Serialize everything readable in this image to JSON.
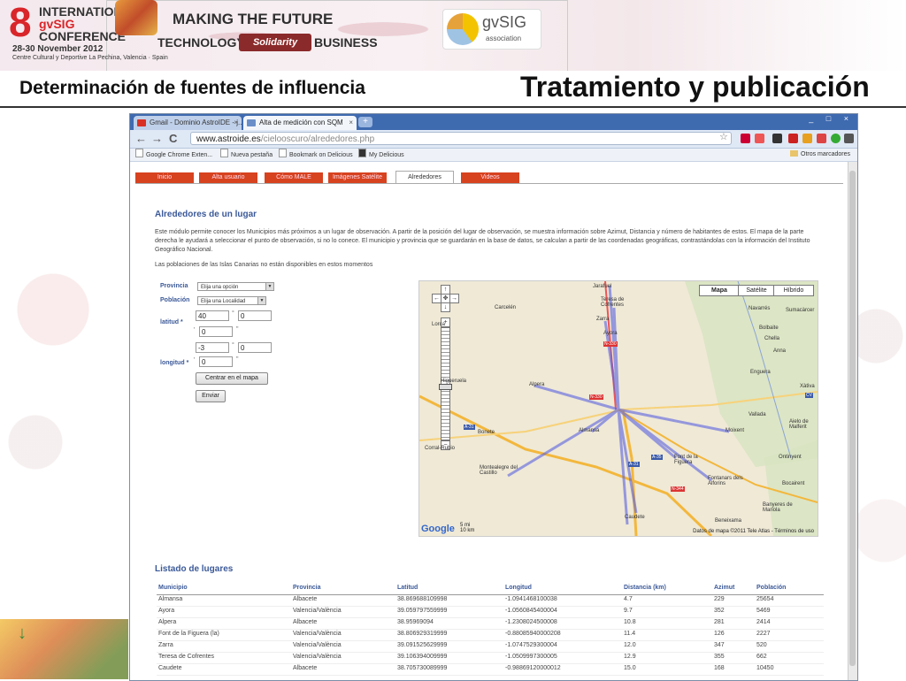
{
  "conference": {
    "number": "8",
    "line1": "INTERNATIONAL",
    "line2": "gvSIG",
    "line3": "CONFERENCE",
    "date": "28-30 November 2012",
    "place": "Centre Cultural y Deportive La Pechina, Valencia · Spain",
    "slogan1": "MAKING THE FUTURE",
    "slogan2": "TECHNOLOGY",
    "slogan_badge": "Solidarity",
    "slogan3": "BUSINESS",
    "logo_name": "gvSIG",
    "logo_sub": "association"
  },
  "slide": {
    "subtitle": "Determinación de fuentes de influencia",
    "title": "Tratamiento y publicación"
  },
  "browser": {
    "tabs": [
      {
        "label": "Gmail - Dominio AstroIDE - j...",
        "fav_color": "#d93025"
      },
      {
        "label": "Alta de medición con SQM",
        "fav_color": "#6a8fc8"
      }
    ],
    "new_tab": "+",
    "window_buttons": "_ □ ×",
    "nav": {
      "back": "←",
      "forward": "→",
      "reload": "C"
    },
    "url_host": "www.astroide.es",
    "url_path": "/cielooscuro/alrededores.php",
    "bookmarks": [
      "Google Chrome Exten...",
      "Nueva pestaña",
      "Bookmark on Delicious",
      "My Delicious"
    ],
    "other_bookmarks": "Otros marcadores",
    "extension_colors": [
      "#c03",
      "#e55",
      "#333",
      "#c22",
      "#e8a020",
      "#d44",
      "#3a3",
      "#555"
    ]
  },
  "site": {
    "menu": [
      "Inicio",
      "Alta usuario",
      "Cómo MALE",
      "Imágenes Satélite",
      "Alrededores",
      "Videos"
    ],
    "active_menu": "Alrededores",
    "heading": "Alrededores de un lugar",
    "intro": "Este módulo permite conocer los Municipios más próximos a un lugar de observación. A partir de la posición del lugar de observación, se muestra información sobre Azimut, Distancia y número de habitantes de estos. El mapa de la parte derecha le ayudará a seleccionar el punto de observación, si no lo conece. El municipio y provincia que se guardarán en la base de datos, se calculan a partir de las coordenadas geográficas, contrastándolas con la información del Instituto Geográfico Nacional.",
    "note": "Las poblaciones de las Islas Canarias no están disponibles en estos momentos",
    "form": {
      "provincia_label": "Provincia",
      "provincia_value": "Elija una opción",
      "poblacion_label": "Población",
      "poblacion_value": "Elija una Localidad",
      "latitud_label": "latitud",
      "lat_deg": "40",
      "lat_min": "0",
      "lat_sec": "0",
      "longitud_label": "longitud",
      "lon_deg": "-3",
      "lon_min": "0",
      "lon_sec": "0",
      "required_mark": "*",
      "deg_symbol": "°",
      "min_symbol": "'",
      "sec_symbol": "\"",
      "center_button": "Centrar en el mapa",
      "send_button": "Enviar"
    },
    "map": {
      "types": [
        "Mapa",
        "Satélite",
        "Híbrido"
      ],
      "active_type": "Mapa",
      "places": [
        "Jarafuel",
        "Teresa de Cofrentes",
        "Zarra",
        "Carcelén",
        "Ayora",
        "Alpera",
        "Almansa",
        "Bonete",
        "Montealegre del Castillo",
        "Caudete",
        "Font de la Figuera",
        "Fontanars dels Alforins",
        "Moixent",
        "Vallada",
        "Enguera",
        "Navarrés",
        "Bolbaite",
        "Chella",
        "Anna",
        "Sumacàrcer",
        "Xàtiva",
        "Aielo de Malferit",
        "Ontinyent",
        "Bocairent",
        "Banyeres de Mariola",
        "Beneixama",
        "Corral-Rubio",
        "Higueruela",
        "Lorca"
      ],
      "roads": [
        "N-330",
        "N-330",
        "A-31",
        "A-31",
        "A-35",
        "N-344",
        "CV"
      ],
      "scale_mi": "5 mi",
      "scale_km": "10 km",
      "copyright": "Datos de mapa ©2011 Tele Atlas - Términos de uso",
      "google": "Google",
      "zoom_in": "+",
      "zoom_out": "−"
    },
    "list_heading": "Listado de lugares",
    "table": {
      "headers": [
        "Municipio",
        "Provincia",
        "Latitud",
        "Longitud",
        "Distancia (km)",
        "Azimut",
        "Población"
      ],
      "rows": [
        [
          "Almansa",
          "Albacete",
          "38.869688109998",
          "-1.0941468100038",
          "4.7",
          "229",
          "25654"
        ],
        [
          "Ayora",
          "Valencia/València",
          "39.059797559999",
          "-1.0560845400004",
          "9.7",
          "352",
          "5469"
        ],
        [
          "Alpera",
          "Albacete",
          "38.95969094",
          "-1.2308024500008",
          "10.8",
          "281",
          "2414"
        ],
        [
          "Font de la Figuera (la)",
          "Valencia/València",
          "38.806929319999",
          "-0.88085940000208",
          "11.4",
          "126",
          "2227"
        ],
        [
          "Zarra",
          "Valencia/València",
          "39.091525629999",
          "-1.0747529300004",
          "12.0",
          "347",
          "520"
        ],
        [
          "Teresa de Cofrentes",
          "Valencia/València",
          "39.106394009999",
          "-1.0509997300005",
          "12.9",
          "355",
          "662"
        ],
        [
          "Caudete",
          "Albacete",
          "38.705730089999",
          "-0.98869120000012",
          "15.0",
          "168",
          "10450"
        ]
      ]
    }
  }
}
